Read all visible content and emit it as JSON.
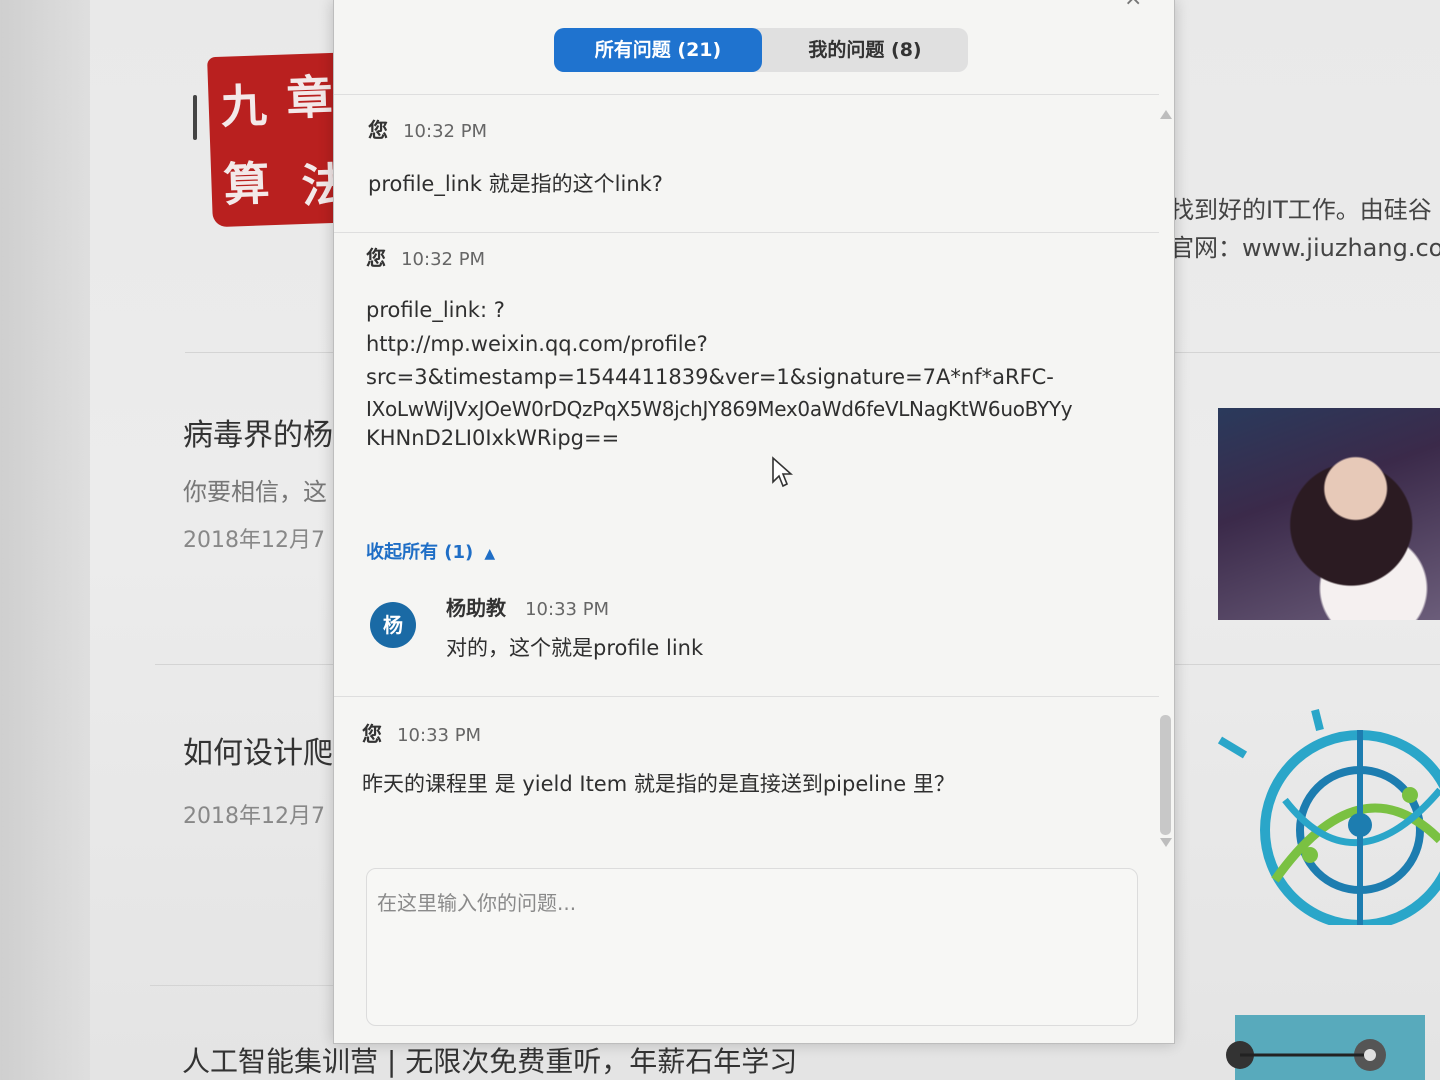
{
  "background_page": {
    "logo_chars": [
      "九",
      "章",
      "算",
      "法"
    ],
    "header_text_1": "找到好的IT工作。由硅谷",
    "header_text_2": "官网：www.jiuzhang.com",
    "article_1": {
      "title": "病毒界的杨",
      "excerpt": "你要相信，这",
      "date": "2018年12月7"
    },
    "article_2": {
      "title": "如何设计爬",
      "date": "2018年12月7"
    },
    "article_3": {
      "title": "人工智能集训营 | 无限次免费重听，年薪石年学习"
    }
  },
  "qa_panel": {
    "tabs": [
      {
        "label": "所有问题 (21)",
        "active": true
      },
      {
        "label": "我的问题 (8)",
        "active": false
      }
    ],
    "messages": [
      {
        "author": "您",
        "time": "10:32 PM",
        "body": "profile_link 就是指的这个link?"
      },
      {
        "author": "您",
        "time": "10:32 PM",
        "body_lines": [
          "profile_link: ?",
          "http://mp.weixin.qq.com/profile?",
          "src=3&timestamp=1544411839&ver=1&signature=7A*nf*aRFC-",
          "IXoLwWiJVxJOeW0rDQzPqX5W8jchJY869Mex0aWd6feVLNagKtW6uoBYYy",
          "KHNnD2LI0IxkWRipg=="
        ],
        "collapse_label": "收起所有 (1)",
        "replies": [
          {
            "avatar_char": "杨",
            "author": "杨助教",
            "time": "10:33 PM",
            "body": "对的，这个就是profile link"
          }
        ]
      },
      {
        "author": "您",
        "time": "10:33 PM",
        "body": "昨天的课程里 是 yield Item  就是指的是直接送到pipeline 里？"
      }
    ],
    "input_placeholder": "在这里输入你的问题...",
    "colors": {
      "accent": "#1f73cf",
      "avatar": "#1a6aa5",
      "link": "#1f6ec6"
    }
  }
}
